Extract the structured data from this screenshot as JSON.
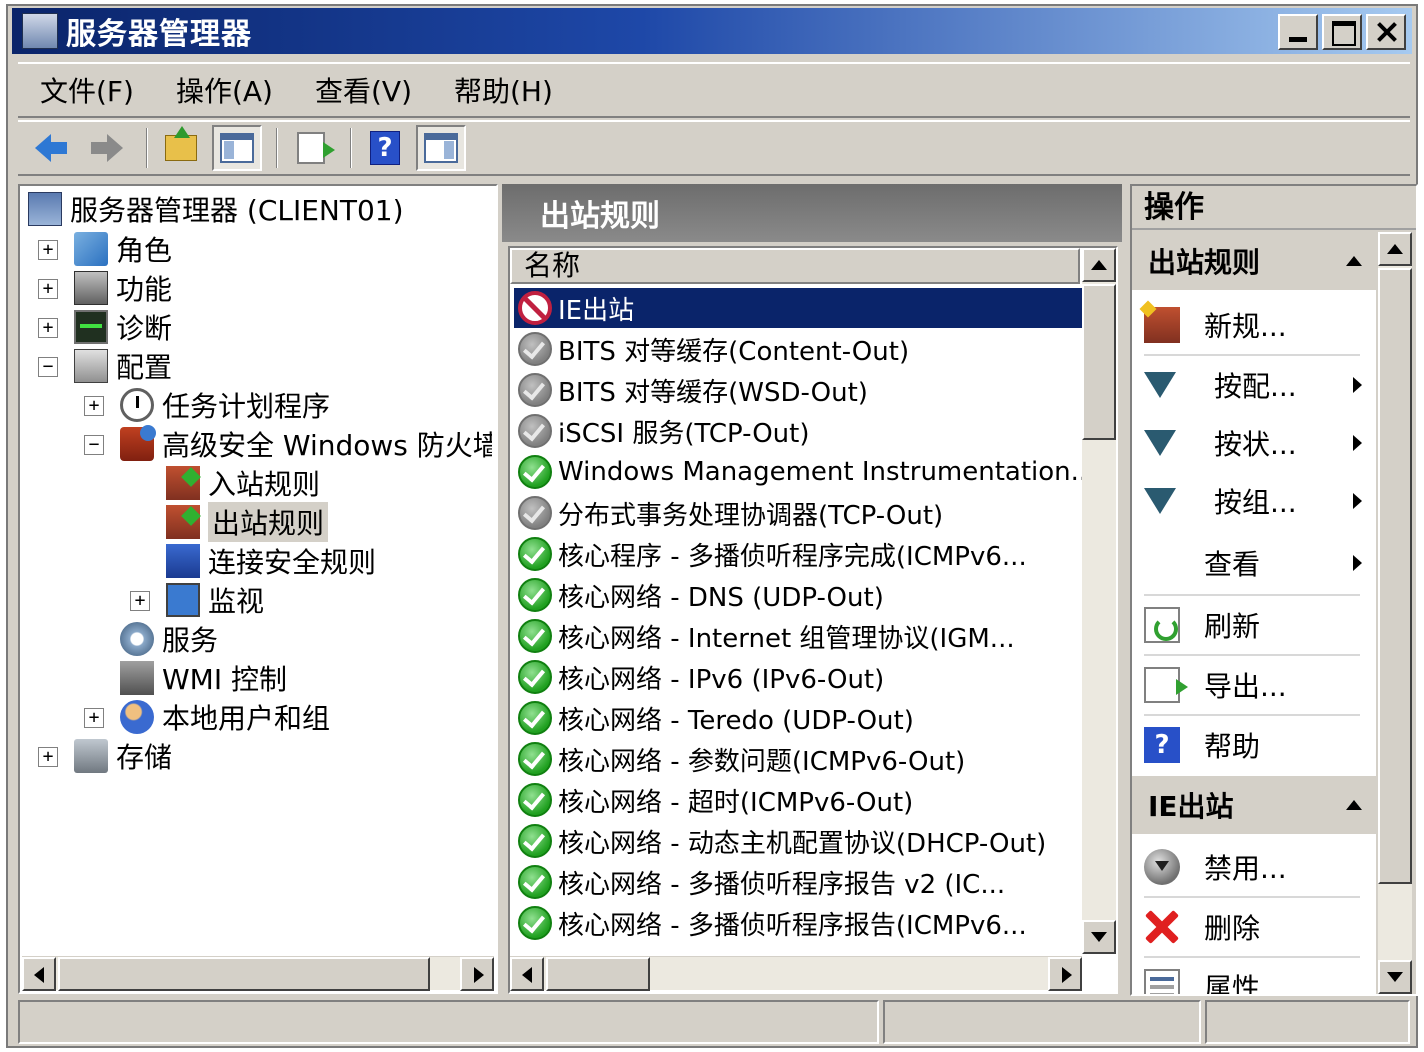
{
  "window": {
    "title": "服务器管理器"
  },
  "menu": [
    {
      "label": "文件(F)"
    },
    {
      "label": "操作(A)"
    },
    {
      "label": "查看(V)"
    },
    {
      "label": "帮助(H)"
    }
  ],
  "toolbar": {
    "icons": [
      "back-arrow-icon",
      "forward-arrow-icon",
      "up-folder-icon",
      "show-hide-tree-icon",
      "export-list-icon",
      "help-icon",
      "show-hide-action-pane-icon"
    ]
  },
  "tree": {
    "root": "服务器管理器 (CLIENT01)",
    "roles": "角色",
    "features": "功能",
    "diagnostics": "诊断",
    "configuration": "配置",
    "task_scheduler": "任务计划程序",
    "firewall": "高级安全 Windows 防火墙",
    "inbound": "入站规则",
    "outbound": "出站规则",
    "connection_security": "连接安全规则",
    "monitoring": "监视",
    "services": "服务",
    "wmi": "WMI 控制",
    "local_users": "本地用户和组",
    "storage": "存储"
  },
  "center": {
    "title": "出站规则",
    "column_name": "名称",
    "rules": [
      {
        "name": "IE出站",
        "status": "block",
        "selected": true
      },
      {
        "name": "BITS 对等缓存(Content-Out)",
        "status": "off"
      },
      {
        "name": "BITS 对等缓存(WSD-Out)",
        "status": "off"
      },
      {
        "name": "iSCSI 服务(TCP-Out)",
        "status": "off"
      },
      {
        "name": "Windows Management Instrumentation...",
        "status": "allow"
      },
      {
        "name": "分布式事务处理协调器(TCP-Out)",
        "status": "off"
      },
      {
        "name": "核心程序 - 多播侦听程序完成(ICMPv6...",
        "status": "allow"
      },
      {
        "name": "核心网络 - DNS (UDP-Out)",
        "status": "allow"
      },
      {
        "name": "核心网络 - Internet 组管理协议(IGM...",
        "status": "allow"
      },
      {
        "name": "核心网络 - IPv6 (IPv6-Out)",
        "status": "allow"
      },
      {
        "name": "核心网络 - Teredo (UDP-Out)",
        "status": "allow"
      },
      {
        "name": "核心网络 - 参数问题(ICMPv6-Out)",
        "status": "allow"
      },
      {
        "name": "核心网络 - 超时(ICMPv6-Out)",
        "status": "allow"
      },
      {
        "name": "核心网络 - 动态主机配置协议(DHCP-Out)",
        "status": "allow"
      },
      {
        "name": "核心网络 - 多播侦听程序报告 v2 (IC...",
        "status": "allow"
      },
      {
        "name": "核心网络 - 多播侦听程序报告(ICMPv6...",
        "status": "allow"
      }
    ]
  },
  "actions": {
    "title": "操作",
    "section1": "出站规则",
    "new_rule": "新规...",
    "filter_profile": "按配...",
    "filter_state": "按状...",
    "filter_group": "按组...",
    "view": "查看",
    "refresh": "刷新",
    "export": "导出...",
    "help": "帮助",
    "section2": "IE出站",
    "disable": "禁用...",
    "delete": "删除",
    "properties": "属性"
  },
  "help_glyph": "?"
}
